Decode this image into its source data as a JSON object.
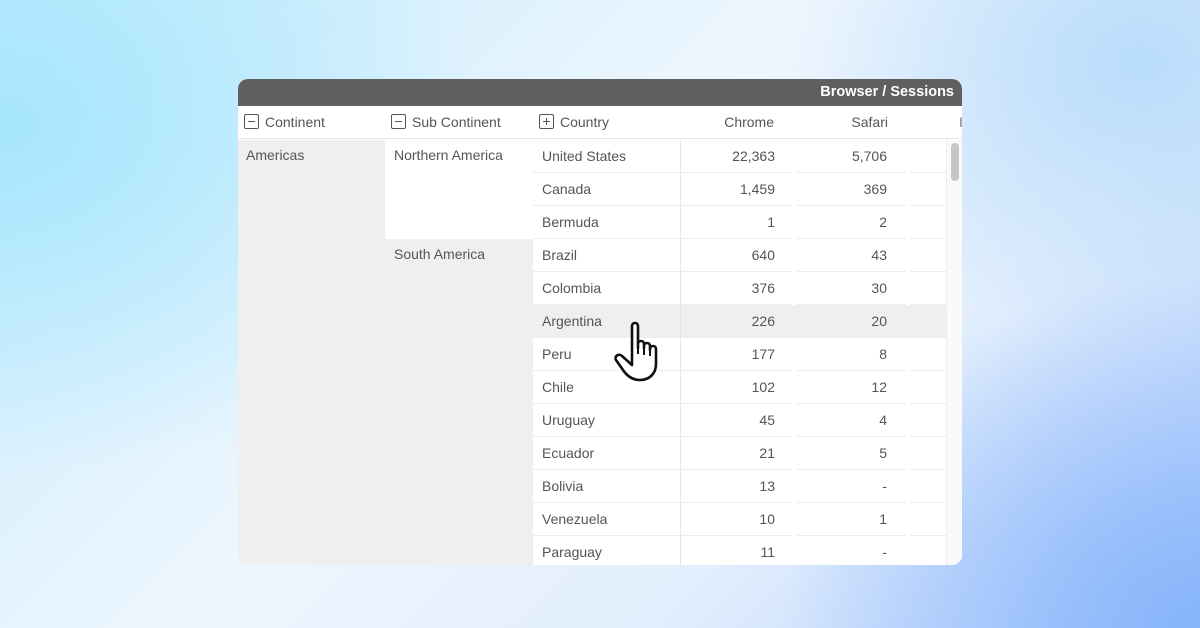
{
  "panel": {
    "title": "Browser / Sessions"
  },
  "columns": {
    "continent": {
      "label": "Continent",
      "toggle": "minus-icon"
    },
    "sub_continent": {
      "label": "Sub Continent",
      "toggle": "minus-icon"
    },
    "country": {
      "label": "Country",
      "toggle": "plus-icon"
    },
    "chrome": {
      "label": "Chrome"
    },
    "safari": {
      "label": "Safari"
    },
    "extra": {
      "label": "I"
    }
  },
  "continent": "Americas",
  "sub_continents": [
    {
      "name": "Northern America",
      "rows": 3,
      "bg": "#ffffff"
    },
    {
      "name": "South America",
      "rows": 10,
      "bg": "#efefef"
    }
  ],
  "rows": [
    {
      "country": "United States",
      "chrome": "22,363",
      "safari": "5,706"
    },
    {
      "country": "Canada",
      "chrome": "1,459",
      "safari": "369"
    },
    {
      "country": "Bermuda",
      "chrome": "1",
      "safari": "2"
    },
    {
      "country": "Brazil",
      "chrome": "640",
      "safari": "43"
    },
    {
      "country": "Colombia",
      "chrome": "376",
      "safari": "30"
    },
    {
      "country": "Argentina",
      "chrome": "226",
      "safari": "20",
      "hovered": true
    },
    {
      "country": "Peru",
      "chrome": "177",
      "safari": "8"
    },
    {
      "country": "Chile",
      "chrome": "102",
      "safari": "12"
    },
    {
      "country": "Uruguay",
      "chrome": "45",
      "safari": "4"
    },
    {
      "country": "Ecuador",
      "chrome": "21",
      "safari": "5"
    },
    {
      "country": "Bolivia",
      "chrome": "13",
      "safari": "-"
    },
    {
      "country": "Venezuela",
      "chrome": "10",
      "safari": "1"
    },
    {
      "country": "Paraguay",
      "chrome": "11",
      "safari": "-"
    }
  ],
  "cursor": "hand-pointer-icon",
  "colors": {
    "title_bar": "#5f5f5f",
    "hover_row": "#efefef",
    "text": "#555555"
  }
}
